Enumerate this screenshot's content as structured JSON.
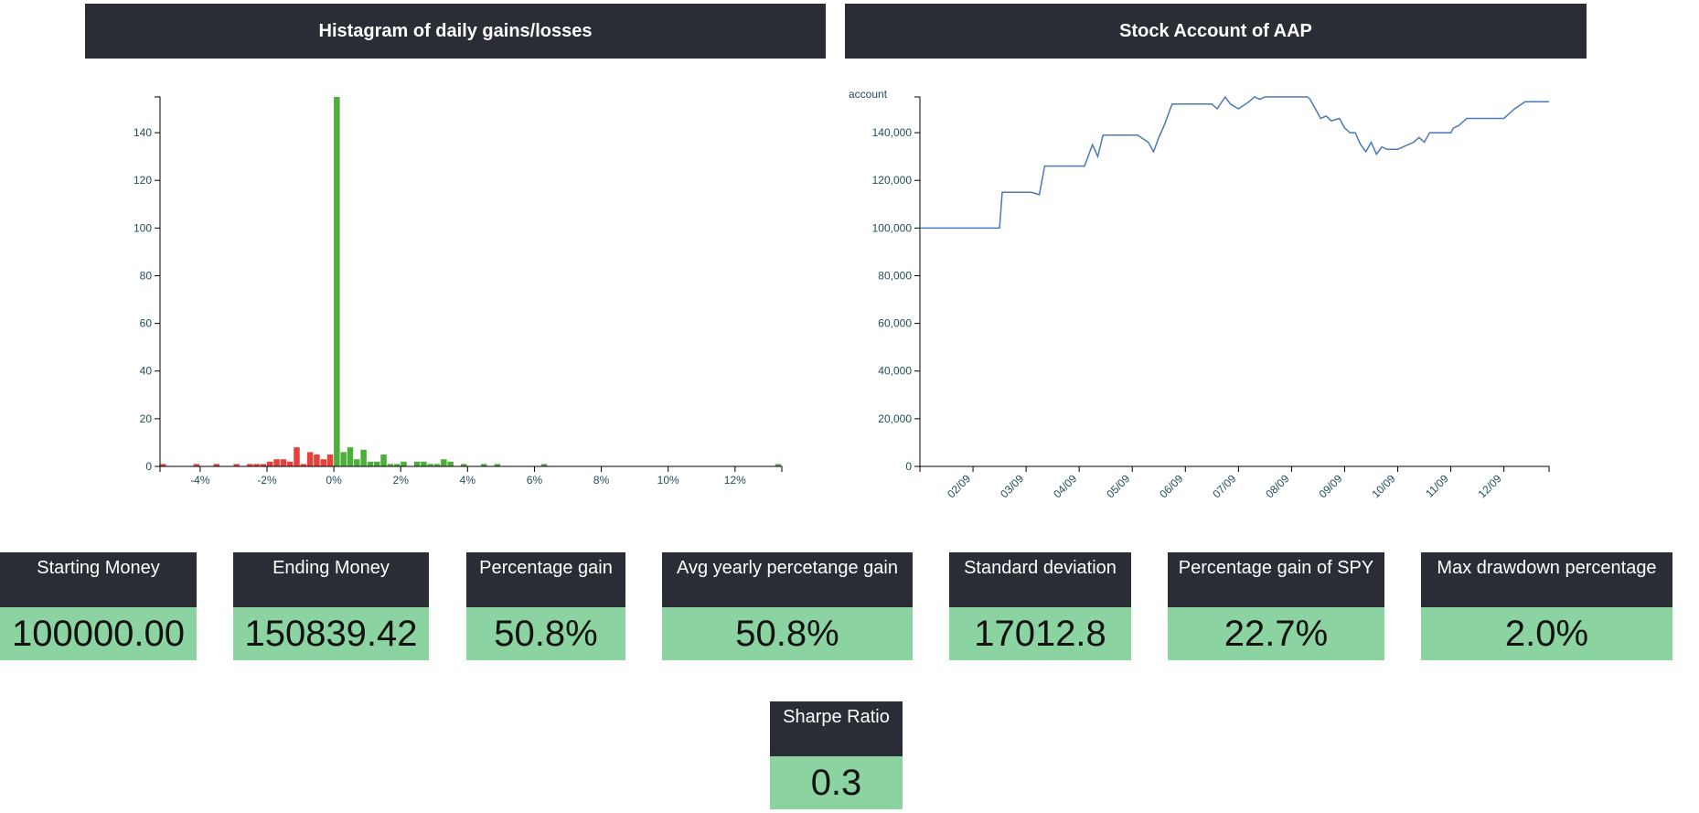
{
  "charts": {
    "histogram_title": "Histagram of daily gains/losses",
    "account_title": "Stock Account of AAP"
  },
  "chart_data": [
    {
      "type": "bar",
      "title": "Histagram of daily gains/losses",
      "xlabel": "",
      "ylabel": "",
      "xlim": [
        -5.2,
        13.4
      ],
      "ylim": [
        0,
        155
      ],
      "x_ticks": [
        "-4%",
        "-2%",
        "0%",
        "2%",
        "4%",
        "6%",
        "8%",
        "10%",
        "12%"
      ],
      "y_ticks": [
        "0",
        "20",
        "40",
        "60",
        "80",
        "100",
        "120",
        "140"
      ],
      "bin_width": 0.2,
      "colors": {
        "loss": "#e8413c",
        "gain": "#4caf3a"
      },
      "bins": [
        {
          "x": -5.2,
          "count": 1
        },
        {
          "x": -4.2,
          "count": 1
        },
        {
          "x": -3.6,
          "count": 1
        },
        {
          "x": -3.0,
          "count": 1
        },
        {
          "x": -2.6,
          "count": 1
        },
        {
          "x": -2.4,
          "count": 1
        },
        {
          "x": -2.2,
          "count": 1
        },
        {
          "x": -2.0,
          "count": 2
        },
        {
          "x": -1.8,
          "count": 3
        },
        {
          "x": -1.6,
          "count": 3
        },
        {
          "x": -1.4,
          "count": 2
        },
        {
          "x": -1.2,
          "count": 8
        },
        {
          "x": -1.0,
          "count": 1
        },
        {
          "x": -0.8,
          "count": 6
        },
        {
          "x": -0.6,
          "count": 5
        },
        {
          "x": -0.4,
          "count": 3
        },
        {
          "x": -0.2,
          "count": 5
        },
        {
          "x": 0.0,
          "count": 155
        },
        {
          "x": 0.2,
          "count": 6
        },
        {
          "x": 0.4,
          "count": 8
        },
        {
          "x": 0.6,
          "count": 3
        },
        {
          "x": 0.8,
          "count": 7
        },
        {
          "x": 1.0,
          "count": 2
        },
        {
          "x": 1.2,
          "count": 2
        },
        {
          "x": 1.4,
          "count": 5
        },
        {
          "x": 1.6,
          "count": 1
        },
        {
          "x": 1.8,
          "count": 1
        },
        {
          "x": 2.0,
          "count": 2
        },
        {
          "x": 2.4,
          "count": 2
        },
        {
          "x": 2.6,
          "count": 2
        },
        {
          "x": 2.8,
          "count": 1
        },
        {
          "x": 3.0,
          "count": 1
        },
        {
          "x": 3.2,
          "count": 3
        },
        {
          "x": 3.4,
          "count": 2
        },
        {
          "x": 3.8,
          "count": 1
        },
        {
          "x": 4.4,
          "count": 1
        },
        {
          "x": 4.8,
          "count": 1
        },
        {
          "x": 6.2,
          "count": 1
        },
        {
          "x": 13.2,
          "count": 1
        }
      ]
    },
    {
      "type": "line",
      "title": "Stock Account of AAP",
      "ylabel": "account",
      "xlabel": "",
      "ylim": [
        0,
        155000
      ],
      "y_ticks": [
        "0",
        "20,000",
        "40,000",
        "60,000",
        "80,000",
        "100,000",
        "120,000",
        "140,000"
      ],
      "x_ticks": [
        "02/09",
        "03/09",
        "04/09",
        "05/09",
        "06/09",
        "07/09",
        "08/09",
        "09/09",
        "10/09",
        "11/09",
        "12/09"
      ],
      "color": "#4a78b8",
      "x_unit": "months",
      "xlim": [
        0,
        11.85
      ],
      "x": [
        0,
        1.5,
        1.55,
        1.65,
        2.1,
        2.25,
        2.35,
        2.45,
        2.95,
        3.1,
        3.25,
        3.35,
        3.45,
        3.6,
        4.1,
        4.3,
        4.4,
        4.5,
        4.6,
        4.75,
        4.9,
        5.05,
        5.5,
        5.6,
        5.75,
        5.85,
        6.0,
        6.2,
        6.3,
        6.4,
        6.5,
        7.0,
        7.3,
        7.35,
        7.5,
        7.55,
        7.65,
        7.75,
        7.9,
        8.0,
        8.1,
        8.2,
        8.3,
        8.4,
        8.5,
        8.6,
        8.7,
        8.8,
        8.9,
        9.0,
        9.3,
        9.4,
        9.5,
        9.6,
        9.7,
        9.8,
        10.0,
        10.05,
        10.15,
        10.3,
        10.4,
        10.5,
        10.6,
        10.65,
        10.75,
        11.0,
        11.2,
        11.4,
        11.85
      ],
      "y": [
        100000,
        100000,
        115000,
        115000,
        115000,
        114000,
        126000,
        126000,
        126000,
        126000,
        135000,
        130000,
        139000,
        139000,
        139000,
        136000,
        132000,
        138000,
        143000,
        152000,
        152000,
        152000,
        152000,
        150000,
        155000,
        152000,
        150000,
        153000,
        155000,
        154000,
        155000,
        155000,
        155000,
        154000,
        148000,
        146000,
        147000,
        145000,
        146000,
        142000,
        140000,
        140000,
        135000,
        132000,
        136000,
        131000,
        134000,
        133000,
        133000,
        133000,
        136000,
        138000,
        136000,
        140000,
        140000,
        140000,
        140000,
        142000,
        143000,
        146000,
        146000,
        146000,
        146000,
        146000,
        146000,
        146000,
        150000,
        153000,
        153000
      ]
    }
  ],
  "stats": [
    {
      "label": "Starting Money",
      "value": "100000.00"
    },
    {
      "label": "Ending Money",
      "value": "150839.42"
    },
    {
      "label": "Percentage gain",
      "value": "50.8%"
    },
    {
      "label": "Avg yearly percetange gain",
      "value": "50.8%"
    },
    {
      "label": "Standard deviation",
      "value": "17012.8"
    },
    {
      "label": "Percentage gain of SPY",
      "value": "22.7%"
    },
    {
      "label": "Max drawdown percentage",
      "value": "2.0%"
    },
    {
      "label": "Sharpe Ratio",
      "value": "0.3"
    }
  ]
}
